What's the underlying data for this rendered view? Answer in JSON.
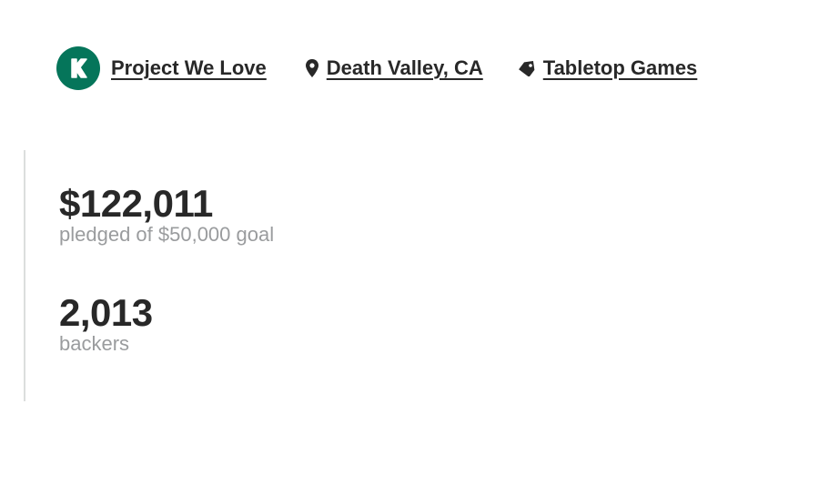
{
  "colors": {
    "brand_green": "#05755a",
    "text_primary": "#282828",
    "text_muted": "#9a9c9e",
    "divider": "#dcdedd"
  },
  "meta": {
    "project_badge": {
      "icon": "kickstarter-k-icon",
      "label": "Project We Love"
    },
    "location": {
      "icon": "map-pin-icon",
      "label": " Death Valley, CA"
    },
    "category": {
      "icon": "tag-icon",
      "label": " Tabletop Games"
    }
  },
  "stats": {
    "pledged": {
      "value": "$122,011",
      "label": "pledged of $50,000 goal"
    },
    "backers": {
      "value": "2,013",
      "label": "backers"
    }
  }
}
